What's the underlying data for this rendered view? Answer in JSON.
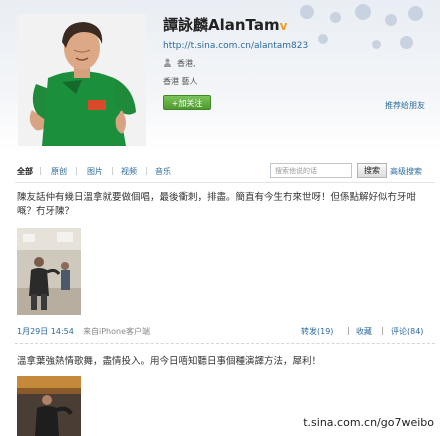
{
  "profile": {
    "name": "譚詠麟AlanTam",
    "verified": "v",
    "url": "http://t.sina.com.cn/alantam823",
    "location": "香港,",
    "tags": "香港 藝人",
    "follow_label": "+加关注",
    "recommend_label": "推荐给朋友"
  },
  "tabs": {
    "items": [
      "全部",
      "原创",
      "图片",
      "视频",
      "音乐"
    ],
    "separator": "|",
    "search_placeholder": "搜索他说的话",
    "search_button": "搜索",
    "advanced": "高级搜索"
  },
  "posts": [
    {
      "text": "陳友話仲有幾日溫拿就要做個唱，最後衝刺，排盡。簡直有今生冇來世呀！但係點解好似冇牙咁嘅？冇牙陳？",
      "time": "1月29日 14:54",
      "source": "来自iPhone客户端",
      "repost": "转发(19)",
      "favorite": "收藏",
      "comment": "评论(84)",
      "separator": "|"
    },
    {
      "text": "溫拿葉強熱情歌舞，盡情投入。用今日唔知聽日事個種演譯方法，犀利！"
    }
  ],
  "watermark": "t.sina.com.cn/go7weibo",
  "colors": {
    "link": "#2c6aa0",
    "follow_green": "#5aa83a",
    "verified_orange": "#f0a01e"
  }
}
